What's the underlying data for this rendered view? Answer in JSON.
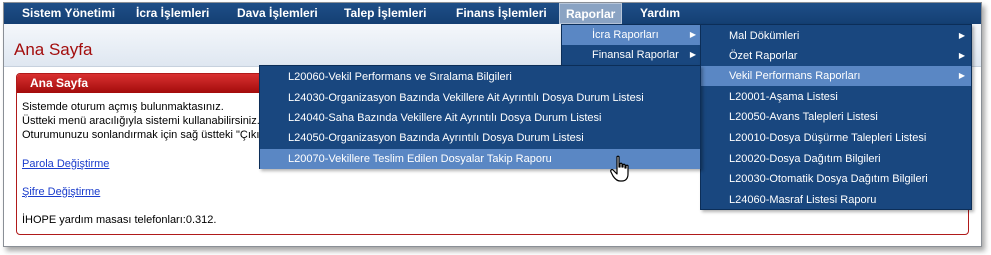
{
  "menubar": {
    "items": [
      {
        "label": "Sistem Yönetimi"
      },
      {
        "label": "İcra İşlemleri"
      },
      {
        "label": "Dava İşlemleri"
      },
      {
        "label": "Talep İşlemleri"
      },
      {
        "label": "Finans İşlemleri"
      },
      {
        "label": "Raporlar"
      },
      {
        "label": "Yardım"
      }
    ],
    "active": "Raporlar"
  },
  "page": {
    "title": "Ana Sayfa"
  },
  "panel": {
    "header": "Ana Sayfa",
    "lines": [
      "Sistemde oturum açmış bulunmaktasınız.",
      "Üstteki menü aracılığıyla sistemi kullanabilirsiniz.",
      "Oturumunuzu sonlandırmak için sağ üstteki \"Çıkış\""
    ],
    "links": [
      "Parola Değiştirme",
      "Şifre Değiştirme"
    ],
    "footer": "İHOPE yardım masası telefonları:0.312."
  },
  "raporlar_menu": {
    "items": [
      {
        "label": "İcra Raporları",
        "has_submenu": true
      },
      {
        "label": "Finansal Raporlar",
        "has_submenu": true
      }
    ],
    "selected": "İcra Raporları"
  },
  "icra_raporlari_menu": {
    "items": [
      {
        "label": "Mal Dökümleri",
        "has_submenu": true
      },
      {
        "label": "Özet Raporlar",
        "has_submenu": true
      },
      {
        "label": "Vekil Performans Raporları",
        "has_submenu": true
      },
      {
        "label": "L20001-Aşama Listesi"
      },
      {
        "label": "L20050-Avans Talepleri Listesi"
      },
      {
        "label": "L20010-Dosya Düşürme Talepleri Listesi"
      },
      {
        "label": "L20020-Dosya Dağıtım Bilgileri"
      },
      {
        "label": "L20030-Otomatik Dosya Dağıtım Bilgileri"
      },
      {
        "label": "L24060-Masraf Listesi Raporu"
      }
    ],
    "selected": "Vekil Performans Raporları"
  },
  "vekil_menu": {
    "items": [
      {
        "label": "L20060-Vekil Performans ve Sıralama Bilgileri"
      },
      {
        "label": "L24030-Organizasyon Bazında Vekillere Ait Ayrıntılı Dosya Durum Listesi"
      },
      {
        "label": "L24040-Saha Bazında Vekillere Ait Ayrıntılı Dosya Durum Listesi"
      },
      {
        "label": "L24050-Organizasyon Bazında Ayrıntılı Dosya Durum Listesi"
      },
      {
        "label": "L20070-Vekillere Teslim Edilen Dosyalar Takip Raporu"
      }
    ],
    "hovered": "L20070-Vekillere Teslim Edilen Dosyalar Takip Raporu"
  },
  "colors": {
    "menubar": "#143f73",
    "dropdown": "#19477f",
    "highlight": "#5a87c4",
    "title_red": "#a30d0d",
    "panel_red": "#b01a1a",
    "link_blue": "#1a3ccc"
  },
  "icons": {
    "submenu": "triangle-right-icon",
    "cursor": "hand-pointer-icon"
  }
}
